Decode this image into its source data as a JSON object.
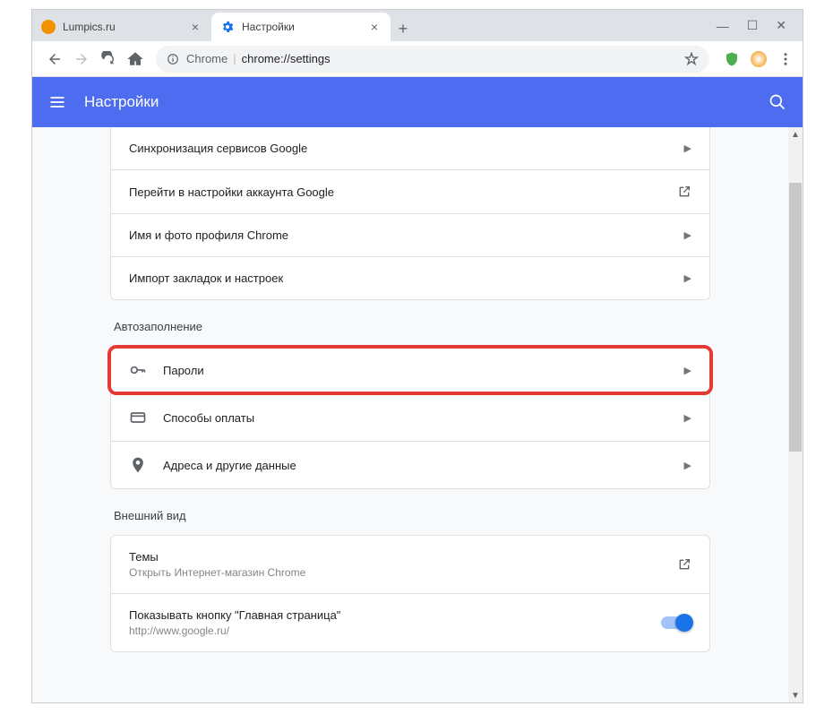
{
  "tabs": [
    {
      "label": "Lumpics.ru",
      "active": false
    },
    {
      "label": "Настройки",
      "active": true
    }
  ],
  "address": {
    "source": "Chrome",
    "url": "chrome://settings"
  },
  "header": {
    "title": "Настройки"
  },
  "section1": {
    "rows": [
      {
        "label": "Синхронизация сервисов Google",
        "icon": "caret"
      },
      {
        "label": "Перейти в настройки аккаунта Google",
        "icon": "external"
      },
      {
        "label": "Имя и фото профиля Chrome",
        "icon": "caret"
      },
      {
        "label": "Импорт закладок и настроек",
        "icon": "caret"
      }
    ]
  },
  "section2": {
    "title": "Автозаполнение",
    "rows": [
      {
        "label": "Пароли"
      },
      {
        "label": "Способы оплаты"
      },
      {
        "label": "Адреса и другие данные"
      }
    ]
  },
  "section3": {
    "title": "Внешний вид",
    "rows": [
      {
        "label": "Темы",
        "sub": "Открыть Интернет-магазин Chrome"
      },
      {
        "label": "Показывать кнопку \"Главная страница\"",
        "sub": "http://www.google.ru/"
      }
    ]
  }
}
